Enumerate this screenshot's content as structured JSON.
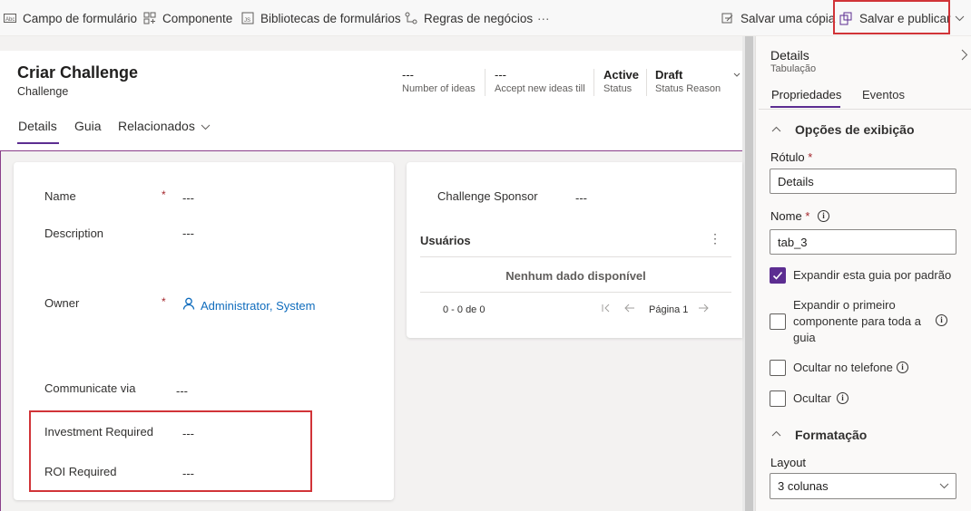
{
  "toolbar": {
    "form_field": "Campo de formulário",
    "component": "Componente",
    "form_libraries": "Bibliotecas de formulários",
    "business_rules": "Regras de negócios",
    "more": "···",
    "save_copy": "Salvar uma cópia",
    "save_publish": "Salvar e publicar"
  },
  "header": {
    "title": "Criar Challenge",
    "entity": "Challenge",
    "fields": [
      {
        "value": "---",
        "label": "Number of ideas"
      },
      {
        "value": "---",
        "label": "Accept new ideas till"
      },
      {
        "value": "Active",
        "label": "Status"
      },
      {
        "value": "Draft",
        "label": "Status Reason"
      }
    ]
  },
  "tabs": [
    "Details",
    "Guia",
    "Relacionados"
  ],
  "left_card": {
    "fields": [
      {
        "label": "Name",
        "value": "---",
        "required": "*"
      },
      {
        "label": "Description",
        "value": "---"
      },
      {
        "label": "Owner",
        "value": "Administrator, System",
        "required": "*"
      },
      {
        "label": "Communicate via",
        "value": "---"
      },
      {
        "label": "Investment Required",
        "value": "---"
      },
      {
        "label": "ROI Required",
        "value": "---"
      }
    ]
  },
  "right_card": {
    "sponsor_label": "Challenge Sponsor",
    "sponsor_value": "---",
    "grid_title": "Usuários",
    "empty_text": "Nenhum dado disponível",
    "pager_count": "0 - 0 de 0",
    "pager_page": "Página 1"
  },
  "panel": {
    "title": "Details",
    "subtitle": "Tabulação",
    "tabs": [
      "Propriedades",
      "Eventos"
    ],
    "display_section": "Opções de exibição",
    "label_label": "Rótulo",
    "label_value": "Details",
    "name_label": "Nome",
    "name_value": "tab_3",
    "required_mark": "*",
    "checkboxes": [
      {
        "label": "Expandir esta guia por padrão",
        "checked": true
      },
      {
        "label": "Expandir o primeiro componente para toda a guia",
        "checked": false
      },
      {
        "label": "Ocultar no telefone",
        "checked": false
      },
      {
        "label": "Ocultar",
        "checked": false
      }
    ],
    "format_section": "Formatação",
    "layout_label": "Layout",
    "layout_value": "3 colunas"
  },
  "colors": {
    "accent": "#5c2d91",
    "highlight": "#d13438",
    "link": "#0f6cbd"
  }
}
